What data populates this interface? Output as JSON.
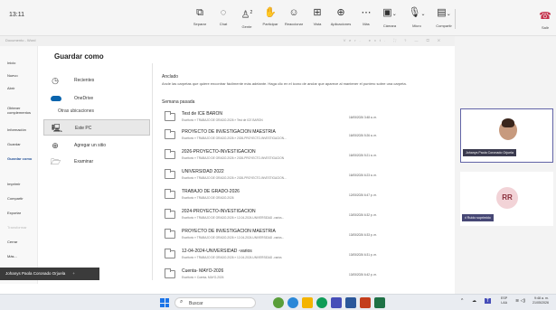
{
  "meeting": {
    "time": "13:11",
    "toolbar": [
      {
        "id": "share",
        "icon": "share-screen-icon",
        "label": "Separar"
      },
      {
        "id": "chat",
        "icon": "chat-icon",
        "label": "Chat"
      },
      {
        "id": "people",
        "icon": "people-icon",
        "label": "Gente",
        "badge": "2"
      },
      {
        "id": "raise",
        "icon": "raise-hand-icon",
        "label": "Participar"
      },
      {
        "id": "react",
        "icon": "react-icon",
        "label": "Reaccionar"
      },
      {
        "id": "view",
        "icon": "view-icon",
        "label": "Vista"
      },
      {
        "id": "apps",
        "icon": "apps-icon",
        "label": "Aplicaciones"
      },
      {
        "id": "more",
        "icon": "more-icon",
        "label": "Más"
      },
      {
        "id": "camera",
        "icon": "camera-icon",
        "label": "Cámara"
      },
      {
        "id": "mic",
        "icon": "mic-icon",
        "label": "Micro"
      },
      {
        "id": "present",
        "icon": "present-icon",
        "label": "Compartir"
      },
      {
        "id": "leave",
        "icon": "phone-hangup-icon",
        "label": "Salir"
      }
    ]
  },
  "doc": {
    "title": "Documento - Word",
    "controls": "Ver. ext.   ⛶   ?   —   ▢   ✕"
  },
  "backstage": {
    "items": [
      "Inicio",
      "Nuevo",
      "Abrir",
      "Obtener complementos",
      "Información",
      "Guardar",
      "Guardar como",
      "Imprimir",
      "Compartir",
      "Exportar",
      "Transformar",
      "Cerrar",
      "Más..."
    ]
  },
  "save_as": {
    "heading": "Guardar como",
    "recent": "Recientes",
    "onedrive": "OneDrive",
    "other_label": "Otras ubicaciones",
    "this_pc": "Este PC",
    "add_place": "Agregar un sitio",
    "browse": "Examinar"
  },
  "files": {
    "pinned_label": "Anclado",
    "pinned_desc": "Ancle las carpetas que quiere encontrar fácilmente más adelante. Haga clic en el icono de anclar que aparece al mantener el puntero sobre una carpeta.",
    "week_label": "Semana pasada",
    "rows": [
      {
        "name": "Test de ICE BARON",
        "path": "Escritorio » TRABAJO DE GRADO-2026 » Test de ICE BARON",
        "date": "16/05/2026 3:48 a. m."
      },
      {
        "name": "PROYECTO DE INVESTIGACION MAESTRIA",
        "path": "Escritorio » TRABAJO DE GRADO-2026 » 2026-PROYECTO-INVESTIGACION...",
        "date": "16/05/2026 5:26 a. m."
      },
      {
        "name": "2026-PROYECTO-INVESTIGACION",
        "path": "Escritorio » TRABAJO DE GRADO-2026 » 2026-PROYECTO-INVESTIGACION",
        "date": "16/05/2026 5:21 a. m."
      },
      {
        "name": "UNIVERSIDAD 2022",
        "path": "Escritorio » TRABAJO DE GRADO-2026 » 2026-PROYECTO-INVESTIGACION...",
        "date": "16/05/2026 6:23 a. m."
      },
      {
        "name": "TRABAJO DE GRADO-2026",
        "path": "Escritorio » TRABAJO DE GRADO-2026",
        "date": "12/05/2026 6:47 p. m."
      },
      {
        "name": "2024-PROYECTO-INVESTIGACION",
        "path": "Escritorio » TRABAJO DE GRADO-2026 » 12-04-2024-UNIVERSIDAD -varios...",
        "date": "13/05/2026 6:32 p. m."
      },
      {
        "name": "PROYECTO DE INVESTIGACION MAESTRIA",
        "path": "Escritorio » TRABAJO DE GRADO-2026 » 12-04-2024-UNIVERSIDAD -varios...",
        "date": "13/05/2026 6:33 p. m."
      },
      {
        "name": "12-04-2024-UNIVERSIDAD -varios",
        "path": "Escritorio » TRABAJO DE GRADO-2026 » 12-04-2024-UNIVERSIDAD -varios",
        "date": "13/05/2026 6:31 p. m."
      },
      {
        "name": "Cuenta- MAYO-2026",
        "path": "Escritorio » Cuenta- MAYO-2026",
        "date": "13/05/2026 6:42 p. m."
      }
    ]
  },
  "presenter": {
    "name": "Johanys Paola Coronado Orjuela",
    "plus": "+"
  },
  "participants": {
    "p1_name": "Johanys Paola Coronado Orjuela",
    "p2_initials": "RR",
    "p2_status": "Ruido suprimido"
  },
  "taskbar": {
    "search_placeholder": "Buscar",
    "lang_top": "ESP",
    "lang_bottom": "LAA",
    "time": "9:48 a. m.",
    "date": "21/05/2026"
  },
  "colors": {
    "accent": "#6264a7",
    "hangup": "#c4314b",
    "word_blue": "#2b579a"
  }
}
